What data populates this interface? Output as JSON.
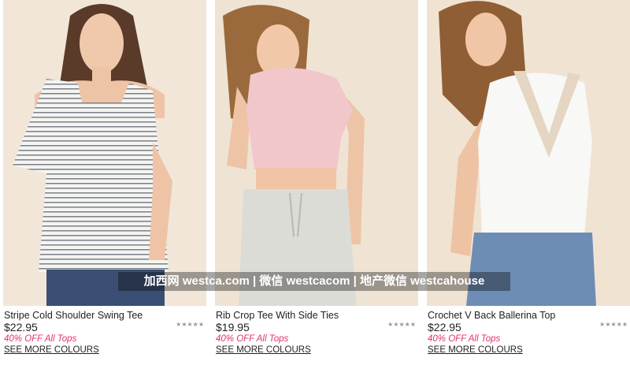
{
  "products": [
    {
      "name": "Stripe Cold Shoulder Swing Tee",
      "price": "$22.95",
      "rating": "★★★★★",
      "promo": "40% OFF All Tops",
      "more": "SEE MORE COLOURS"
    },
    {
      "name": "Rib Crop Tee With Side Ties",
      "price": "$19.95",
      "rating": "★★★★★",
      "promo": "40% OFF All Tops",
      "more": "SEE MORE COLOURS"
    },
    {
      "name": "Crochet V Back Ballerina Top",
      "price": "$22.95",
      "rating": "★★★★★",
      "promo": "40% OFF All Tops",
      "more": "SEE MORE COLOURS"
    }
  ],
  "watermark": "加西网 westca.com | 微信 westcacom | 地产微信 westcahouse",
  "colors": {
    "promo": "#e0326e",
    "photo_bg": "#efe4d4",
    "rating": "#9a9a9a"
  }
}
